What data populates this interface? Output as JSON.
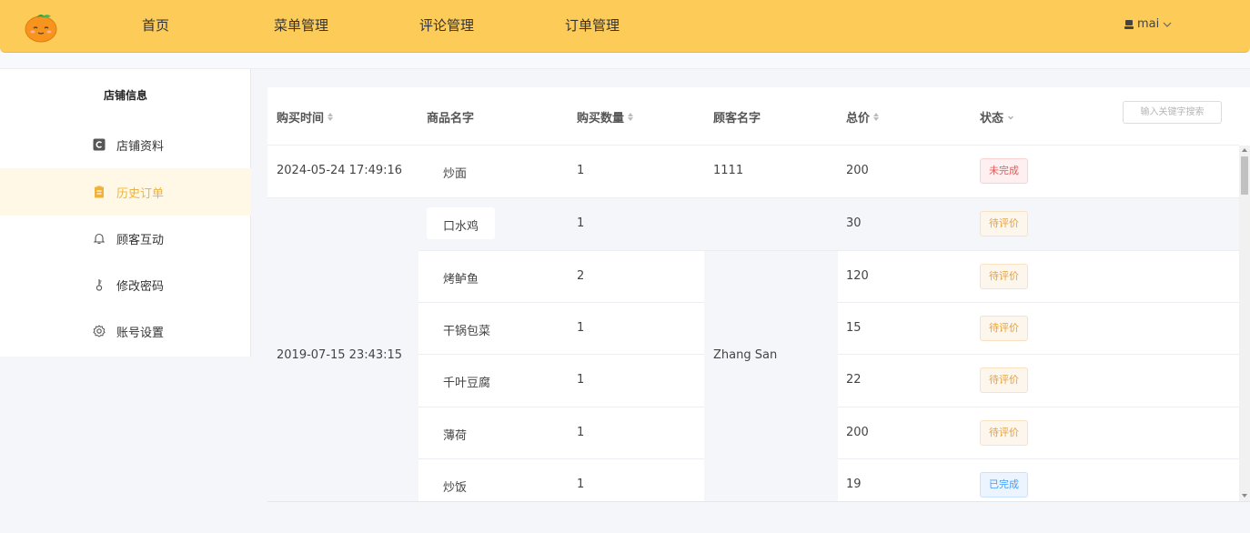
{
  "nav": {
    "items": [
      {
        "label": "首页"
      },
      {
        "label": "菜单管理"
      },
      {
        "label": "评论管理"
      },
      {
        "label": "订单管理"
      }
    ],
    "user": "mai"
  },
  "sidebar": {
    "title": "店铺信息",
    "items": [
      {
        "label": "店铺资料",
        "icon": "store-info-icon"
      },
      {
        "label": "历史订单",
        "icon": "clipboard-icon",
        "active": true
      },
      {
        "label": "顾客互动",
        "icon": "bell-icon"
      },
      {
        "label": "修改密码",
        "icon": "key-icon"
      },
      {
        "label": "账号设置",
        "icon": "gear-icon"
      }
    ]
  },
  "table": {
    "headers": {
      "time": "购买时间",
      "name": "商品名字",
      "qty": "购买数量",
      "customer": "顾客名字",
      "total": "总价",
      "status": "状态"
    },
    "search_placeholder": "输入关键字搜索",
    "orders": [
      {
        "time": "2024-05-24 17:49:16",
        "customer": "1111",
        "items": [
          {
            "name": "炒面",
            "qty": "1",
            "total": "200",
            "status": "未完成"
          }
        ]
      },
      {
        "time": "2019-07-15 23:43:15",
        "customer": "Zhang San",
        "items": [
          {
            "name": "口水鸡",
            "qty": "1",
            "total": "30",
            "status": "待评价"
          },
          {
            "name": "烤鲈鱼",
            "qty": "2",
            "total": "120",
            "status": "待评价"
          },
          {
            "name": "干锅包菜",
            "qty": "1",
            "total": "15",
            "status": "待评价"
          },
          {
            "name": "千叶豆腐",
            "qty": "1",
            "total": "22",
            "status": "待评价"
          },
          {
            "name": "薄荷",
            "qty": "1",
            "total": "200",
            "status": "待评价"
          },
          {
            "name": "炒饭",
            "qty": "1",
            "total": "19",
            "status": "已完成"
          }
        ]
      }
    ]
  },
  "colors": {
    "topbar": "#fdcb58",
    "active_bg": "#fff8e6",
    "active_text": "#f0b23a",
    "status_pending": "#e35a5a",
    "status_review": "#e6a23c",
    "status_done": "#409eff"
  }
}
